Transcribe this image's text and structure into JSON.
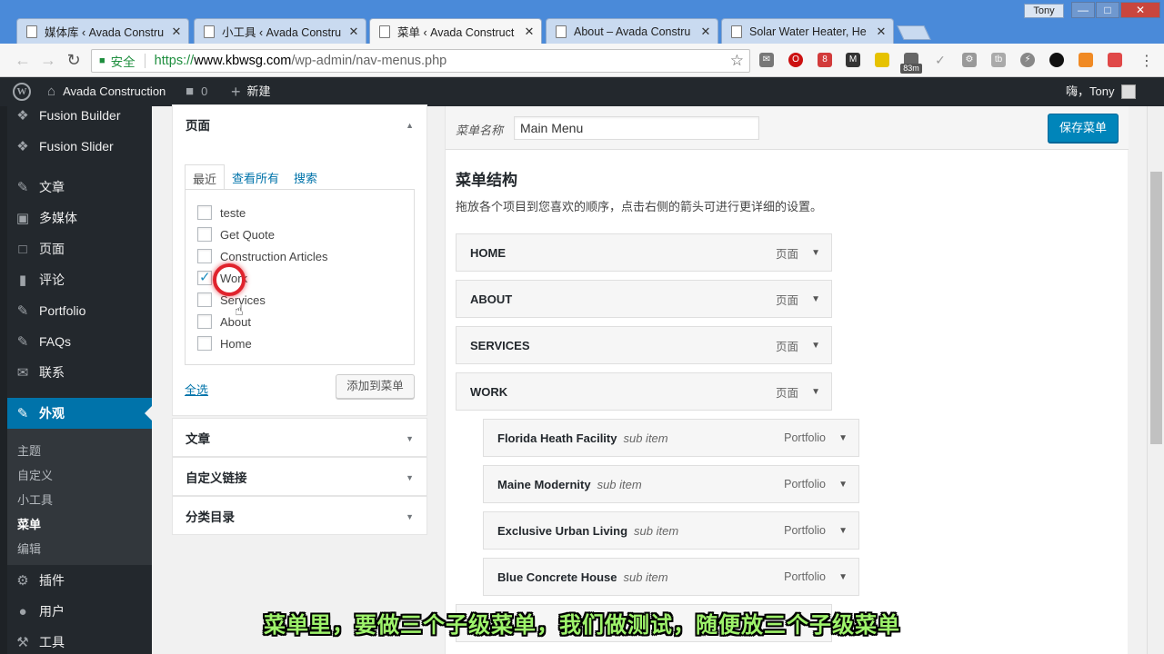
{
  "browser": {
    "tabs": [
      {
        "label": "媒体库 ‹ Avada Constru",
        "active": false
      },
      {
        "label": "小工具 ‹ Avada Constru",
        "active": false
      },
      {
        "label": "菜单 ‹ Avada Construct",
        "active": true
      },
      {
        "label": "About – Avada Constru",
        "active": false
      },
      {
        "label": "Solar Water Heater, He",
        "active": false
      }
    ],
    "close_glyph": "✕",
    "window_user": "Tony",
    "secure_label": "安全",
    "url_scheme": "https://",
    "url_host": "www.kbwsg.com",
    "url_path": "/wp-admin/nav-menus.php",
    "ext_badge": "83m"
  },
  "adminbar": {
    "site_name": "Avada Construction",
    "comments_count": "0",
    "new_label": "新建",
    "greeting": "嗨，Tony"
  },
  "sidebar": {
    "items": [
      {
        "label": "Fusion Builder",
        "icon": "fusion-icon"
      },
      {
        "label": "Fusion Slider",
        "icon": "fusion-icon"
      },
      {
        "label": "文章",
        "icon": "pushpin-icon"
      },
      {
        "label": "多媒体",
        "icon": "media-icon"
      },
      {
        "label": "页面",
        "icon": "page-icon"
      },
      {
        "label": "评论",
        "icon": "comment-icon"
      },
      {
        "label": "Portfolio",
        "icon": "pushpin-icon"
      },
      {
        "label": "FAQs",
        "icon": "pushpin-icon"
      },
      {
        "label": "联系",
        "icon": "mail-icon"
      },
      {
        "label": "外观",
        "icon": "brush-icon"
      },
      {
        "label": "插件",
        "icon": "plugin-icon"
      },
      {
        "label": "用户",
        "icon": "user-icon"
      },
      {
        "label": "工具",
        "icon": "wrench-icon"
      }
    ],
    "submenu": [
      "主题",
      "自定义",
      "小工具",
      "菜单",
      "编辑"
    ],
    "current_submenu": "菜单"
  },
  "pages_box": {
    "title": "页面",
    "tabs": [
      "最近",
      "查看所有",
      "搜索"
    ],
    "items": [
      {
        "label": "teste",
        "checked": false
      },
      {
        "label": "Get Quote",
        "checked": false
      },
      {
        "label": "Construction Articles",
        "checked": false
      },
      {
        "label": "Work",
        "checked": true
      },
      {
        "label": "Services",
        "checked": false
      },
      {
        "label": "About",
        "checked": false
      },
      {
        "label": "Home",
        "checked": false
      }
    ],
    "select_all": "全选",
    "add_button": "添加到菜单"
  },
  "collapsed_boxes": [
    "文章",
    "自定义链接",
    "分类目录"
  ],
  "menu": {
    "name_label": "菜单名称",
    "name_value": "Main Menu",
    "save_button": "保存菜单",
    "structure_title": "菜单结构",
    "structure_desc": "拖放各个项目到您喜欢的顺序，点击右侧的箭头可进行更详细的设置。",
    "items": [
      {
        "title": "HOME",
        "type": "页面",
        "depth": 0
      },
      {
        "title": "ABOUT",
        "type": "页面",
        "depth": 0
      },
      {
        "title": "SERVICES",
        "type": "页面",
        "depth": 0
      },
      {
        "title": "WORK",
        "type": "页面",
        "depth": 0
      },
      {
        "title": "Florida Heath Facility",
        "type": "Portfolio",
        "depth": 1,
        "sub": "sub item"
      },
      {
        "title": "Maine Modernity",
        "type": "Portfolio",
        "depth": 1,
        "sub": "sub item"
      },
      {
        "title": "Exclusive Urban Living",
        "type": "Portfolio",
        "depth": 1,
        "sub": "sub item"
      },
      {
        "title": "Blue Concrete House",
        "type": "Portfolio",
        "depth": 1,
        "sub": "sub item"
      }
    ]
  },
  "caption": "菜单里，要做三个子级菜单，我们做测试，随便放三个子级菜单"
}
